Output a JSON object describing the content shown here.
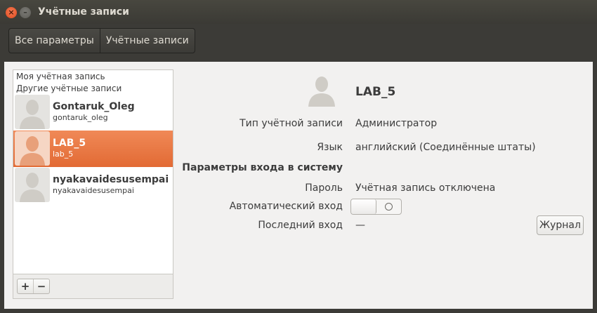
{
  "window": {
    "title": "Учётные записи"
  },
  "breadcrumbs": [
    {
      "label": "Все параметры"
    },
    {
      "label": "Учётные записи"
    }
  ],
  "sidebar": {
    "section_mine": "Моя учётная запись",
    "section_others": "Другие учётные записи",
    "users": [
      {
        "name": "Gontaruk_Oleg",
        "login": "gontaruk_oleg",
        "selected": false
      },
      {
        "name": "LAB_5",
        "login": "lab_5",
        "selected": true
      },
      {
        "name": "nyakavaidesusempai",
        "login": "nyakavaidesusempai",
        "selected": false
      }
    ],
    "add_label": "+",
    "remove_label": "−"
  },
  "detail": {
    "name": "LAB_5",
    "account_type_label": "Тип учётной записи",
    "account_type_value": "Администратор",
    "language_label": "Язык",
    "language_value": "английский (Соединённые штаты)",
    "login_section_title": "Параметры входа в систему",
    "password_label": "Пароль",
    "password_value": "Учётная запись отключена",
    "autologin_label": "Автоматический вход",
    "autologin_enabled": false,
    "last_login_label": "Последний вход",
    "last_login_value": "—",
    "log_button_label": "Журнал"
  },
  "colors": {
    "accent": "#e8703a",
    "titlebar": "#3c3b37",
    "background": "#f2f1f0"
  }
}
